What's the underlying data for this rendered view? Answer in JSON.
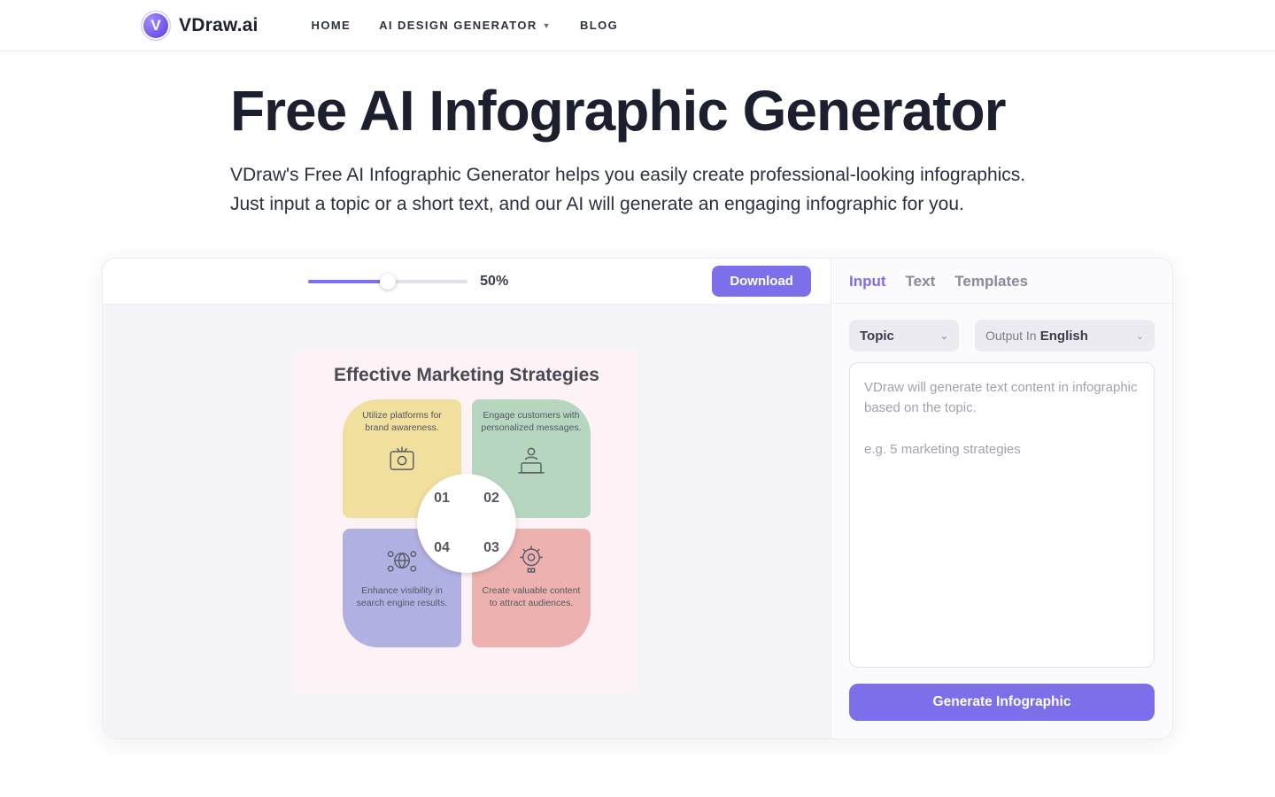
{
  "brand": {
    "mark": "V",
    "name": "VDraw.ai"
  },
  "nav": {
    "home": "HOME",
    "generator": "AI DESIGN GENERATOR",
    "blog": "BLOG"
  },
  "hero": {
    "title": "Free AI Infographic Generator",
    "body": "VDraw's Free AI Infographic Generator helps you easily create professional-looking infographics. Just input a topic or a short text, and our AI will generate an engaging infographic for you."
  },
  "stage": {
    "zoom": "50%",
    "download": "Download"
  },
  "poster": {
    "title": "Effective Marketing Strategies",
    "q1": "Utilize platforms for brand awareness.",
    "q2": "Engage customers with personalized messages.",
    "q3": "Create valuable content to attract audiences.",
    "q4": "Enhance visibility in search engine results.",
    "n1": "01",
    "n2": "02",
    "n3": "03",
    "n4": "04"
  },
  "panel": {
    "tabs": {
      "input": "Input",
      "text": "Text",
      "templates": "Templates"
    },
    "topic_label": "Topic",
    "output_label": "Output In",
    "output_lang": "English",
    "placeholder": "VDraw will generate text content in infographic based on the topic.\n\ne.g. 5 marketing strategies",
    "generate": "Generate Infographic"
  }
}
